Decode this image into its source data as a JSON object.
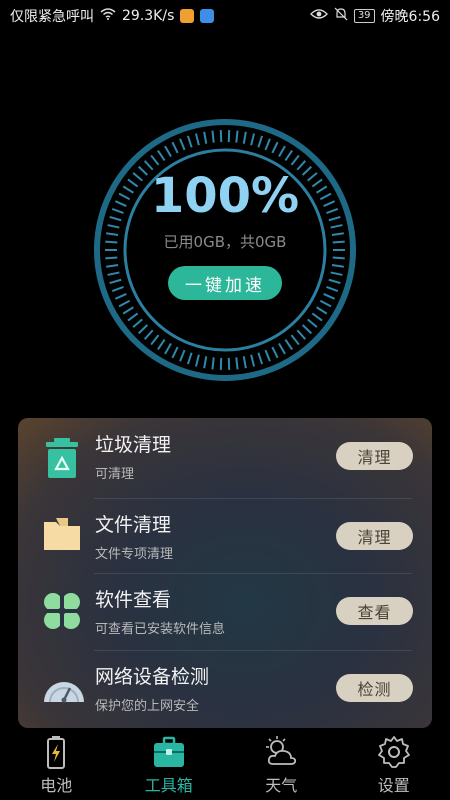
{
  "status_bar": {
    "left_text": "仅限紧急呼叫",
    "speed": "29.3K/s",
    "battery": "39",
    "time": "傍晚6:56"
  },
  "dial": {
    "percent": "100%",
    "usage": "已用0GB，共0GB",
    "boost_label": "一键加速"
  },
  "tools": [
    {
      "title": "垃圾清理",
      "subtitle": "可清理",
      "button": "清理",
      "icon": "trash-recycle-icon"
    },
    {
      "title": "文件清理",
      "subtitle": "文件专项清理",
      "button": "清理",
      "icon": "folder-icon"
    },
    {
      "title": "软件查看",
      "subtitle": "可查看已安装软件信息",
      "button": "查看",
      "icon": "clover-apps-icon"
    },
    {
      "title": "网络设备检测",
      "subtitle": "保护您的上网安全",
      "button": "检测",
      "icon": "speedometer-icon"
    }
  ],
  "bottom_nav": [
    {
      "label": "电池",
      "icon": "battery-icon",
      "active": false
    },
    {
      "label": "工具箱",
      "icon": "toolbox-icon",
      "active": true
    },
    {
      "label": "天气",
      "icon": "weather-icon",
      "active": false
    },
    {
      "label": "设置",
      "icon": "gear-icon",
      "active": false
    }
  ],
  "colors": {
    "accent": "#2db79a",
    "percent_text": "#8fd2f2",
    "ring": "#1f6e8a"
  }
}
